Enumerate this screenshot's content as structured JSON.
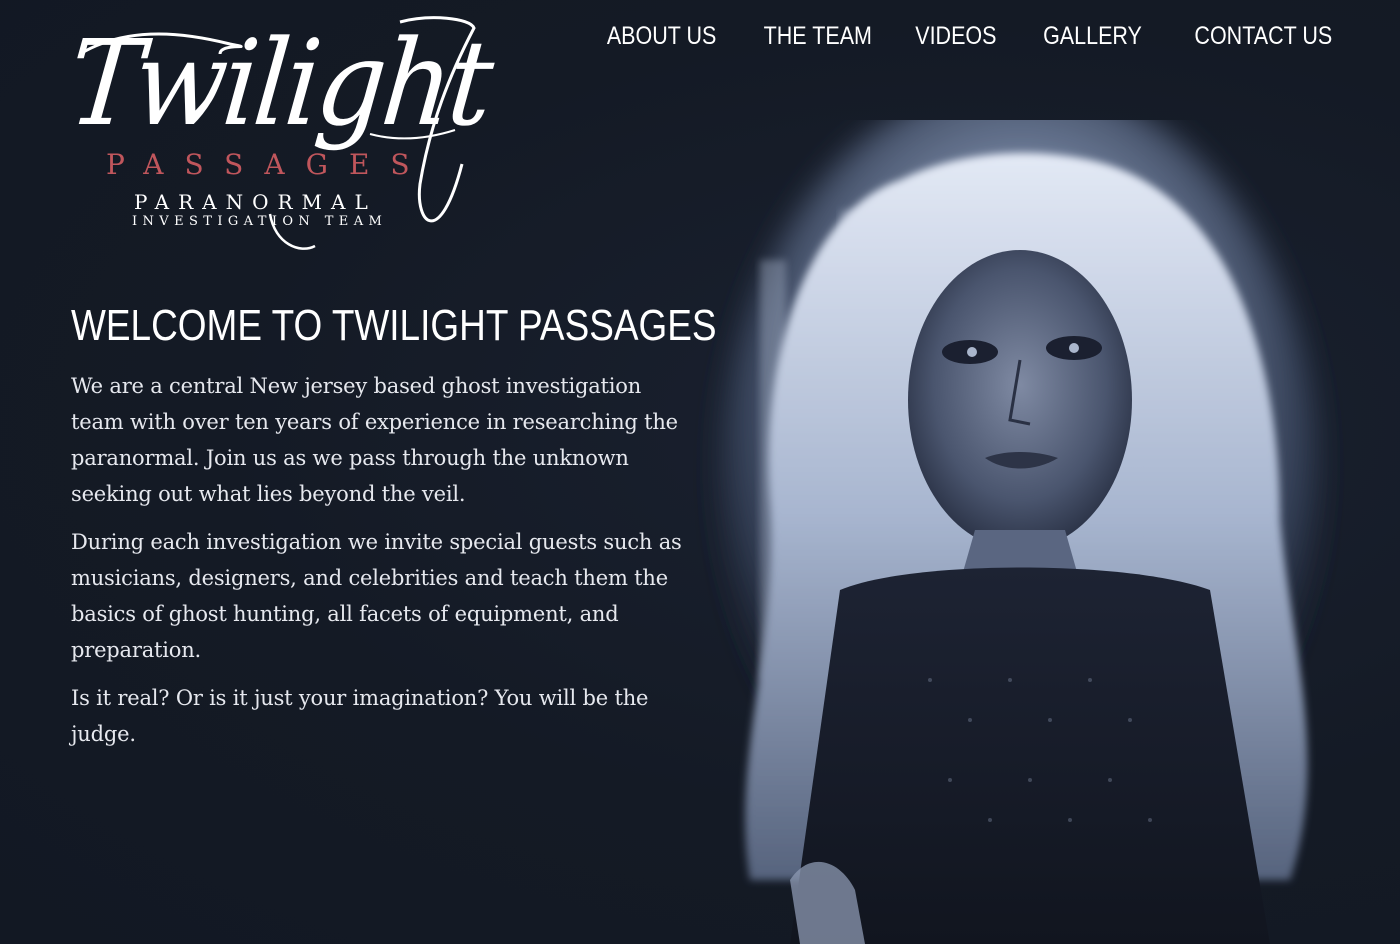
{
  "logo": {
    "script": "Twilight",
    "passages": "PASSAGES",
    "paranormal": "PARANORMAL",
    "team": "INVESTIGATION TEAM"
  },
  "nav": {
    "items": [
      {
        "label": "ABOUT US"
      },
      {
        "label": "THE TEAM"
      },
      {
        "label": "VIDEOS"
      },
      {
        "label": "GALLERY"
      },
      {
        "label": "CONTACT US"
      }
    ]
  },
  "main": {
    "heading": "WELCOME TO TWILIGHT PASSAGES",
    "paragraphs": [
      "We are a central New jersey based ghost investigation team with over ten years of experience in researching the paranormal. Join us as we pass through the unknown seeking out what lies beyond the veil.",
      "During each investigation we invite special guests such as musicians, designers, and celebrities and teach them the basics of ghost hunting, all facets of equipment, and preparation.",
      "Is it real? Or is it just your imagination? You will be the judge."
    ]
  },
  "colors": {
    "background": "#141a25",
    "accent": "#c0565c",
    "text": "#ffffff",
    "hero_tint": "#9aa9c4"
  }
}
